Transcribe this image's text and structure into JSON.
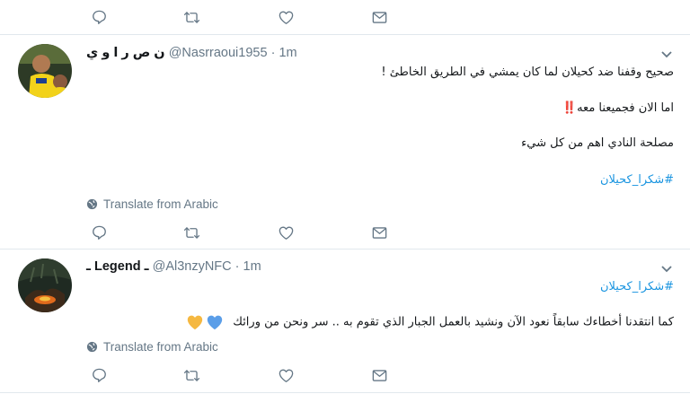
{
  "tweets": [
    {
      "display_name": "ن ص ر ا و ي",
      "handle": "@Nasrraoui1955",
      "separator": "·",
      "time": "1m",
      "lines": [
        "صحيح وقفنا ضد كحيلان لما كان يمشي في الطريق الخاطئ !",
        "اما الان فجميعنا معه‼️",
        "مصلحة النادي اهم من كل شيء"
      ],
      "hashtag": "#شكرا_كحيلان",
      "translate": "Translate from Arabic"
    },
    {
      "display_name": "ـ Legend ـ",
      "handle": "@Al3nzyNFC",
      "separator": "·",
      "time": "1m",
      "hashtag": "#شكرا_كحيلان",
      "text": "كما انتقدنا أخطاءك سابقاً نعود الآن ونشيد بالعمل الجبار الذي تقوم به .. سر ونحن من ورائك",
      "emoji_colors": [
        "#f5b841",
        "#5b9ee8"
      ],
      "translate": "Translate from Arabic"
    }
  ],
  "actions": {
    "icons": [
      "reply-icon",
      "retweet-icon",
      "like-icon",
      "direct-message-icon"
    ]
  },
  "colors": {
    "link": "#1b95e0",
    "muted": "#657786",
    "divider": "#e1e8ed"
  }
}
